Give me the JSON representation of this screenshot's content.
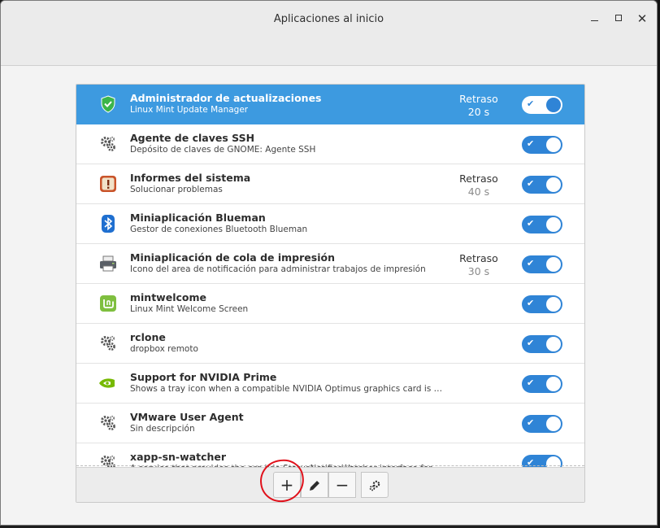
{
  "window": {
    "title": "Aplicaciones al inicio"
  },
  "delay_label": "Retraso",
  "apps": [
    {
      "name": "Administrador de actualizaciones",
      "desc": "Linux Mint Update Manager",
      "delay": "20 s",
      "icon": "shield-icon",
      "selected": true,
      "enabled": true
    },
    {
      "name": "Agente de claves SSH",
      "desc": "Depósito de claves de GNOME: Agente SSH",
      "delay": "",
      "icon": "gears-icon",
      "selected": false,
      "enabled": true
    },
    {
      "name": "Informes del sistema",
      "desc": "Solucionar problemas",
      "delay": "40 s",
      "icon": "warning-icon",
      "selected": false,
      "enabled": true
    },
    {
      "name": "Miniaplicación Blueman",
      "desc": "Gestor de conexiones Bluetooth Blueman",
      "delay": "",
      "icon": "bluetooth-icon",
      "selected": false,
      "enabled": true
    },
    {
      "name": "Miniaplicación de cola de impresión",
      "desc": "Icono del area de notificación para administrar trabajos de impresión",
      "delay": "30 s",
      "icon": "printer-icon",
      "selected": false,
      "enabled": true
    },
    {
      "name": "mintwelcome",
      "desc": "Linux Mint Welcome Screen",
      "delay": "",
      "icon": "mint-logo-icon",
      "selected": false,
      "enabled": true
    },
    {
      "name": "rclone",
      "desc": "dropbox remoto",
      "delay": "",
      "icon": "gears-icon",
      "selected": false,
      "enabled": true
    },
    {
      "name": "Support for NVIDIA Prime",
      "desc": "Shows a tray icon when a compatible NVIDIA Optimus graphics card is det...",
      "delay": "",
      "icon": "nvidia-icon",
      "selected": false,
      "enabled": true
    },
    {
      "name": "VMware User Agent",
      "desc": "Sin descripción",
      "delay": "",
      "icon": "gears-icon",
      "selected": false,
      "enabled": true
    },
    {
      "name": "xapp-sn-watcher",
      "desc": "A service that provides the org.kde.StatusNotifierWatcher interface for XA...",
      "delay": "",
      "icon": "gears-icon",
      "selected": false,
      "enabled": true
    }
  ],
  "toolbar": {
    "add": "+",
    "edit_icon": "pencil-icon",
    "remove": "−",
    "run_icon": "gear-run-icon"
  },
  "colors": {
    "accent": "#3d9ae0",
    "switch": "#2f84d6",
    "annotation": "#e0101a"
  }
}
